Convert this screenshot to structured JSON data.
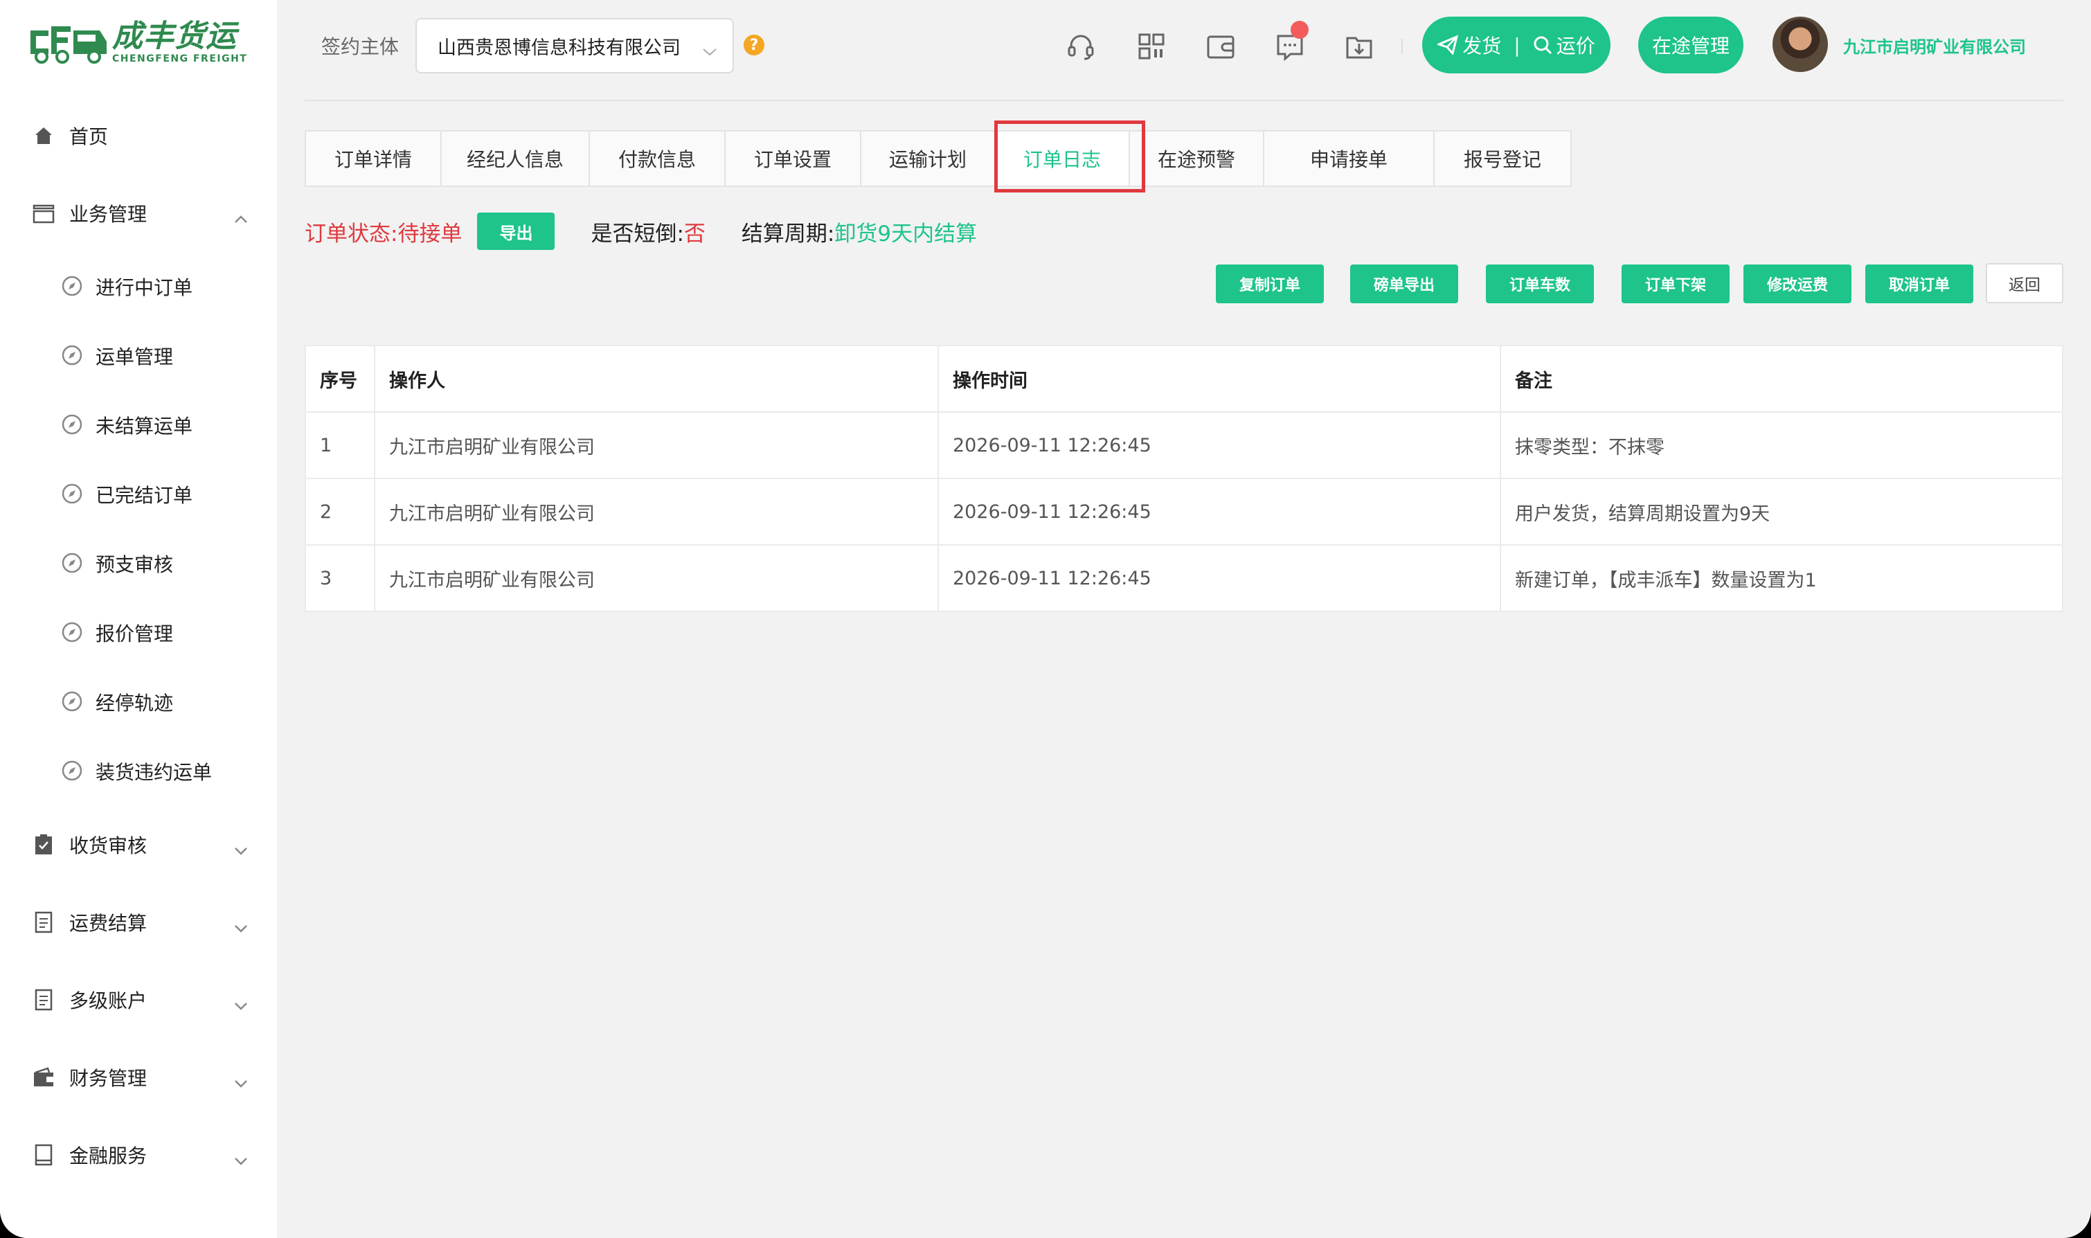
{
  "brand": {
    "name_cn": "成丰货运",
    "name_en": "CHENGFENG FREIGHT",
    "accent": "#1ec48a",
    "logo_green": "#2f8a4f"
  },
  "sidebar": {
    "home": "首页",
    "business": "业务管理",
    "sub_items": [
      "进行中订单",
      "运单管理",
      "未结算运单",
      "已完结订单",
      "预支审核",
      "报价管理",
      "经停轨迹",
      "装货违约运单"
    ],
    "groups": [
      "收货审核",
      "运费结算",
      "多级账户",
      "财务管理",
      "金融服务"
    ]
  },
  "header": {
    "sign_label": "签约主体",
    "sign_value": "山西贵恩博信息科技有限公司",
    "ship_label": "发货",
    "price_label": "运价",
    "transit_label": "在途管理",
    "company": "九江市启明矿业有限公司",
    "icons": [
      "headset-icon",
      "qrcode-icon",
      "wallet-icon",
      "message-icon",
      "download-icon"
    ]
  },
  "tabs": [
    "订单详情",
    "经纪人信息",
    "付款信息",
    "订单设置",
    "运输计划",
    "订单日志",
    "在途预警",
    "申请接单",
    "报号登记"
  ],
  "active_tab": "订单日志",
  "status": {
    "order_status_label": "订单状态: ",
    "order_status_value": "待接单",
    "export_label": "导出",
    "short_label": "是否短倒: ",
    "short_value": "否",
    "settle_label": "结算周期: ",
    "settle_value": "卸货9天内结算"
  },
  "actions": [
    "复制订单",
    "磅单导出",
    "订单车数",
    "订单下架",
    "修改运费",
    "取消订单"
  ],
  "back_label": "返回",
  "table": {
    "headers": [
      "序号",
      "操作人",
      "操作时间",
      "备注"
    ],
    "rows": [
      [
        "1",
        "九江市启明矿业有限公司",
        "2026-09-11 12:26:45",
        "抹零类型：不抹零"
      ],
      [
        "2",
        "九江市启明矿业有限公司",
        "2026-09-11 12:26:45",
        "用户发货，结算周期设置为9天"
      ],
      [
        "3",
        "九江市启明矿业有限公司",
        "2026-09-11 12:26:45",
        "新建订单，【成丰派车】数量设置为1"
      ]
    ]
  }
}
